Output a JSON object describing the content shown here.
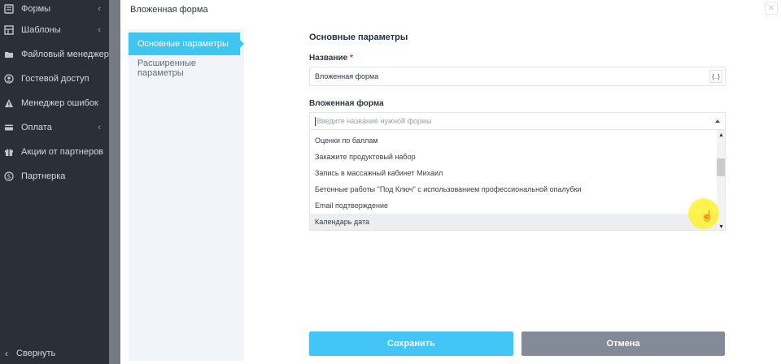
{
  "sidebar": {
    "items": [
      {
        "label": "Формы",
        "icon": "forms-icon",
        "has_children": true
      },
      {
        "label": "Шаблоны",
        "icon": "templates-icon",
        "has_children": true
      },
      {
        "label": "Файловый менеджер",
        "icon": "file-manager-icon",
        "has_children": false
      },
      {
        "label": "Гостевой доступ",
        "icon": "guest-access-icon",
        "has_children": false
      },
      {
        "label": "Менеджер ошибок",
        "icon": "warning-icon",
        "has_children": false
      },
      {
        "label": "Оплата",
        "icon": "payment-icon",
        "has_children": true
      },
      {
        "label": "Акции от партнеров",
        "icon": "gift-icon",
        "has_children": false
      },
      {
        "label": "Партнерка",
        "icon": "dollar-icon",
        "has_children": false
      }
    ],
    "collapse_label": "Свернуть"
  },
  "modal": {
    "title": "Вложенная форма",
    "close_icon": "close-icon",
    "tabs": [
      {
        "label": "Основные параметры",
        "active": true
      },
      {
        "label": "Расширенные параметры",
        "active": false
      }
    ],
    "section_title": "Основные параметры",
    "name_field": {
      "label": "Название",
      "required_mark": "*",
      "value": "Вложенная форма",
      "var_button": "{..}"
    },
    "nested_form_field": {
      "label": "Вложенная форма",
      "placeholder": "Введите название нужной формы",
      "options": [
        "Оценки по баллам",
        "Закажите продуктовый набор",
        "Запись в массажный кабинет Михаил",
        "Бетонные работы \"Под Ключ\" с использованием профессиональной опалубки",
        "Email подтверждение",
        "Календарь дата"
      ],
      "hovered_option": "Календарь дата"
    },
    "buttons": {
      "save": "Сохранить",
      "cancel": "Отмена"
    }
  },
  "colors": {
    "accent": "#3fc5f0",
    "cancel": "#838b99",
    "sidebar_bg": "#2b2f37",
    "required": "#e0343b"
  }
}
